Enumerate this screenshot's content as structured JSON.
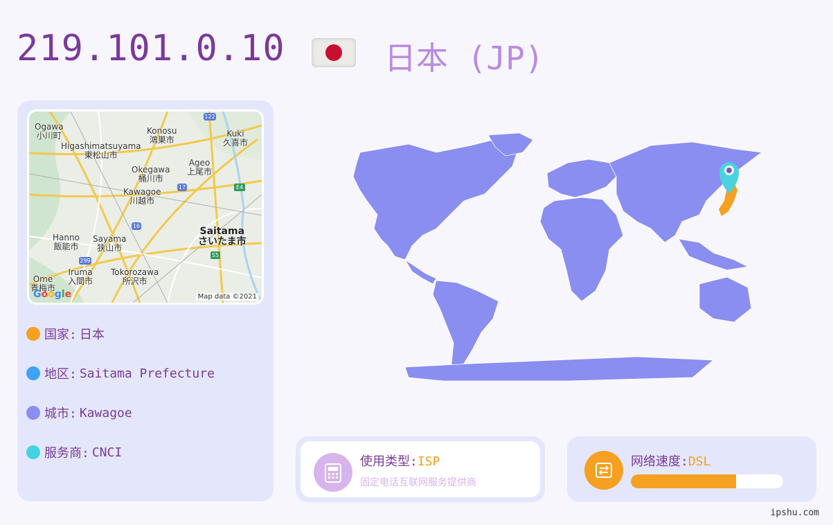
{
  "header": {
    "ip": "219.101.0.10",
    "country_title": "日本 (JP)",
    "flag_icon": "japan-flag-icon"
  },
  "mini_map": {
    "labels": [
      {
        "text": "Ogawa",
        "sub": "小川町"
      },
      {
        "text": "Konosu",
        "sub": "鴻巣市"
      },
      {
        "text": "Kuki",
        "sub": "久喜市"
      },
      {
        "text": "Higashimatsuyama",
        "sub": "東松山市"
      },
      {
        "text": "Okegawa",
        "sub": "桶川市"
      },
      {
        "text": "Ageo",
        "sub": "上尾市"
      },
      {
        "text": "Kawagoe",
        "sub": "川越市"
      },
      {
        "text": "Saitama",
        "sub": "さいたま市"
      },
      {
        "text": "Hanno",
        "sub": "飯能市"
      },
      {
        "text": "Sayama",
        "sub": "狭山市"
      },
      {
        "text": "Tokorozawa",
        "sub": "所沢市"
      },
      {
        "text": "Iruma",
        "sub": "入間市"
      },
      {
        "text": "Ome",
        "sub": "青梅市"
      }
    ],
    "route_badges": [
      "122",
      "17",
      "E4",
      "16",
      "S5",
      "299"
    ],
    "logo": "Google",
    "credit": "Map data ©2021"
  },
  "info": {
    "country_label": "国家:",
    "country_value": "日本",
    "region_label": "地区:",
    "region_value": "Saitama Prefecture",
    "city_label": "城市:",
    "city_value": "Kawagoe",
    "isp_label": "服务商:",
    "isp_value": "CNCI"
  },
  "usage": {
    "label": "使用类型:",
    "value": "ISP",
    "description": "固定电话互联网服务提供商",
    "icon": "telephone-icon"
  },
  "speed": {
    "label": "网络速度:",
    "value": "DSL",
    "level": 0.69,
    "icon": "network-drive-icon"
  },
  "watermark": "ipshu.com",
  "colors": {
    "title": "#7a3a9a",
    "accent": "#f5a020",
    "country_bullet": "#f5a020",
    "region_bullet": "#3fa3f5",
    "city_bullet": "#8a8ef0",
    "isp_bullet": "#3fd4e0",
    "map_land": "#8a8ef0",
    "map_highlight": "#f5a020",
    "pin": "#4ad2e0"
  }
}
